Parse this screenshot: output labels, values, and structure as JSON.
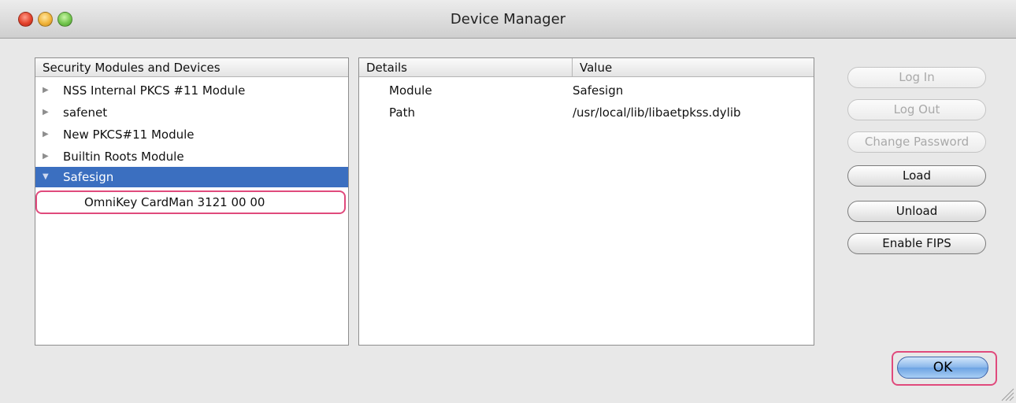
{
  "window": {
    "title": "Device Manager"
  },
  "modules_list": {
    "header": "Security Modules and Devices",
    "items": [
      {
        "label": "NSS Internal PKCS #11 Module"
      },
      {
        "label": "safenet"
      },
      {
        "label": "New PKCS#11 Module"
      },
      {
        "label": "Builtin Roots Module"
      },
      {
        "label": "Safesign",
        "selected": true
      }
    ],
    "child": {
      "label": "OmniKey CardMan 3121 00 00"
    }
  },
  "details": {
    "columns": [
      "Details",
      "Value"
    ],
    "rows": [
      {
        "key": "Module",
        "value": "Safesign"
      },
      {
        "key": "Path",
        "value": "/usr/local/lib/libaetpkss.dylib"
      }
    ]
  },
  "buttons": {
    "log_in": "Log In",
    "log_out": "Log Out",
    "change_password": "Change Password",
    "load": "Load",
    "unload": "Unload",
    "enable_fips": "Enable FIPS",
    "ok": "OK"
  },
  "colors": {
    "selection": "#3b6fc0",
    "highlight_ring": "#e04a7c",
    "default_button": "#87b5ea"
  }
}
